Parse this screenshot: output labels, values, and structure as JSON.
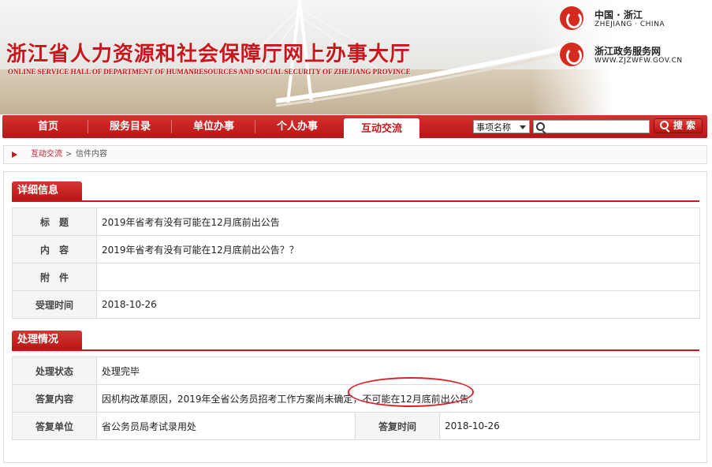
{
  "header": {
    "title": "浙江省人力资源和社会保障厅网上办事大厅",
    "subtitle": "ONLINE SERVICE HALL OF DEPARTMENT OF HUMANRESOURCES AND SOCIAL SECURITY OF ZHEJIANG PROVINCE",
    "logo1_name": "中国 · 浙江",
    "logo1_sub": "ZHEJIANG · CHINA",
    "logo2_name": "浙江政务服务网",
    "logo2_sub": "WWW.ZJZWFW.GOV.CN"
  },
  "nav": {
    "items": [
      "首页",
      "服务目录",
      "单位办事",
      "个人办事",
      "互动交流"
    ],
    "active_index": 4
  },
  "search": {
    "select_value": "事项名称",
    "input_value": "",
    "button_label": "搜 索"
  },
  "breadcrumb": {
    "link": "互动交流",
    "separator": ">",
    "current": "信件内容"
  },
  "detail": {
    "heading": "详细信息",
    "rows": [
      {
        "label": "标　题",
        "value": "2019年省考有没有可能在12月底前出公告"
      },
      {
        "label": "内　容",
        "value": "2019年省考有没有可能在12月底前出公告？？"
      },
      {
        "label": "附　件",
        "value": ""
      },
      {
        "label": "受理时间",
        "value": "2018-10-26"
      }
    ]
  },
  "handling": {
    "heading": "处理情况",
    "status_label": "处理状态",
    "status_value": "处理完毕",
    "reply_label": "答复内容",
    "reply_value": "因机构改革原因，2019年全省公务员招考工作方案尚未确定，不可能在12月底前出公告。",
    "unit_label": "答复单位",
    "unit_value": "省公务员局考试录用处",
    "time_label": "答复时间",
    "time_value": "2018-10-26"
  },
  "colors": {
    "brand_red": "#c8161d",
    "annotation_red": "#d8212a"
  }
}
